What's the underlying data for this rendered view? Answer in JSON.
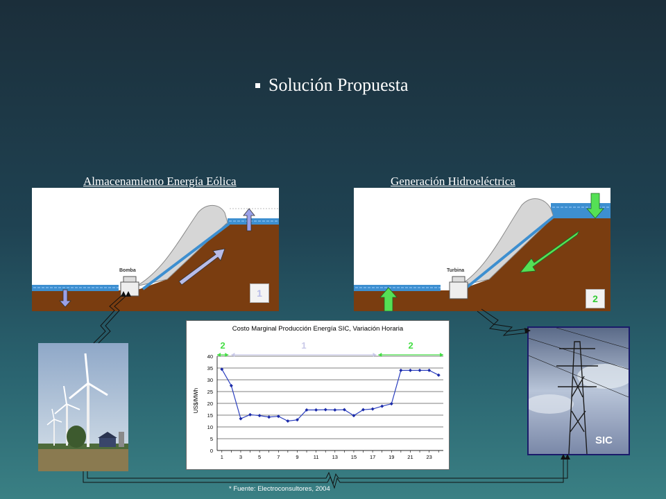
{
  "slide": {
    "title": "Solución Propuesta",
    "left_label": "Almacenamiento  Energía Eólica",
    "right_label": "Generación Hidroeléctrica",
    "left_panel": {
      "component_label": "Bomba",
      "badge": "1"
    },
    "right_panel": {
      "component_label": "Turbina",
      "badge": "2"
    },
    "source": "* Fuente: Electroconsultores, 2004",
    "sic_label": "SIC"
  },
  "chart_data": {
    "type": "line",
    "title": "Costo Marginal Producción Energía SIC, Variación Horaria",
    "xlabel": "",
    "ylabel": "US$/MWh",
    "x": [
      1,
      2,
      3,
      4,
      5,
      6,
      7,
      8,
      9,
      10,
      11,
      12,
      13,
      14,
      15,
      16,
      17,
      18,
      19,
      20,
      21,
      22,
      23,
      24
    ],
    "x_ticks": [
      1,
      3,
      5,
      7,
      9,
      11,
      13,
      15,
      17,
      19,
      21,
      23
    ],
    "y_ticks": [
      0,
      5,
      10,
      15,
      20,
      25,
      30,
      35,
      40
    ],
    "ylim": [
      0,
      40
    ],
    "series": [
      {
        "values": [
          34.5,
          27.5,
          13.5,
          15.2,
          14.8,
          14.2,
          14.5,
          12.5,
          13.0,
          17.2,
          17.2,
          17.3,
          17.2,
          17.3,
          14.8,
          17.3,
          17.6,
          18.8,
          19.8,
          34.0,
          34.0,
          34.0,
          34.0,
          32.0
        ]
      }
    ],
    "annotations": [
      {
        "label": "2",
        "from": 0.5,
        "to": 1.7,
        "color": "#44dd44"
      },
      {
        "label": "1",
        "from": 2.0,
        "to": 17.4,
        "color": "#c8c8e8"
      },
      {
        "label": "2",
        "from": 17.6,
        "to": 24.5,
        "color": "#44dd44"
      }
    ],
    "colors": {
      "line": "#2b3fbf",
      "marker": "#1a2aa8",
      "grid": "#000000"
    }
  }
}
